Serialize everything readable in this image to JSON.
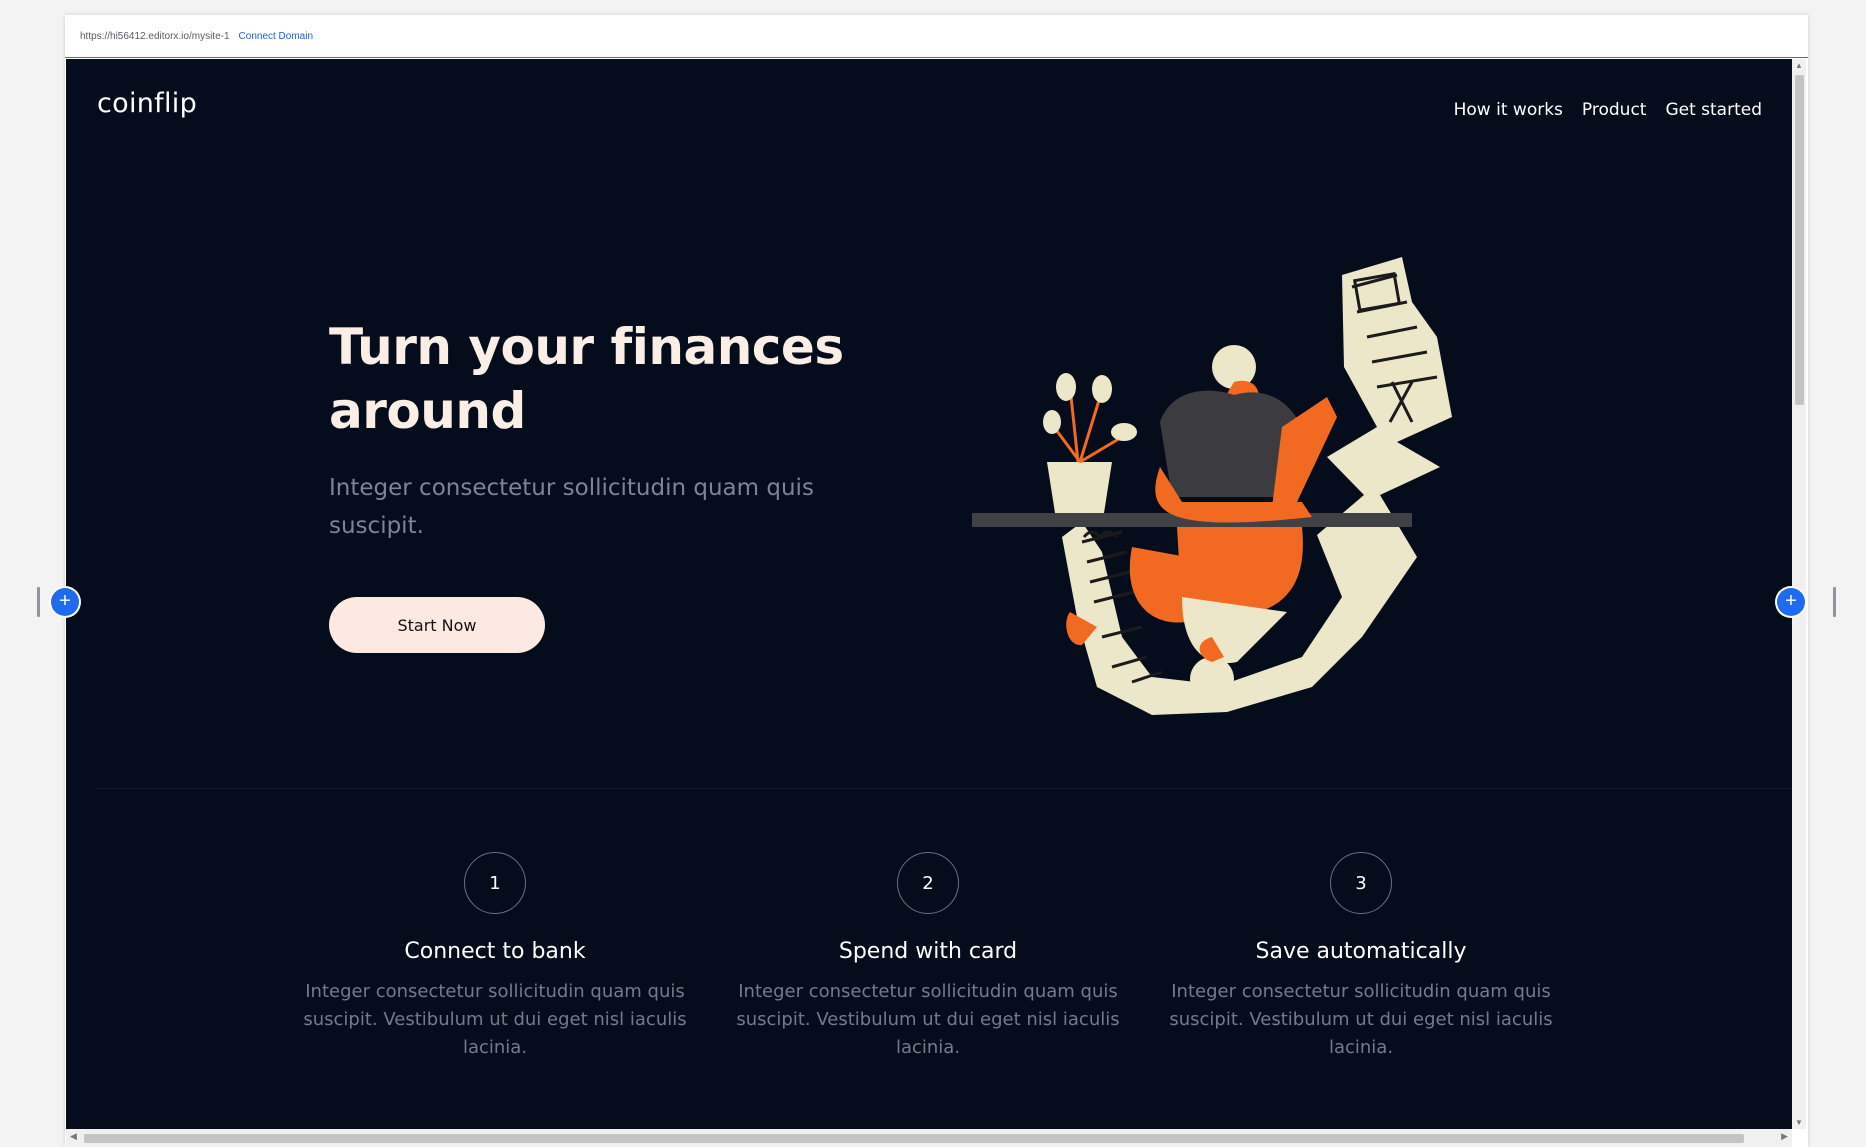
{
  "editor": {
    "url": "https://hi56412.editorx.io/mysite-1",
    "connect_domain": "Connect Domain"
  },
  "site": {
    "logo": "coinflip",
    "nav": [
      "How it works",
      "Product",
      "Get started"
    ],
    "hero": {
      "title": "Turn your finances around",
      "subtitle": "Integer consectetur sollicitudin quam quis suscipit.",
      "cta": "Start Now"
    },
    "steps": [
      {
        "number": "1",
        "title": "Connect to bank",
        "description": "Integer consectetur sollicitudin quam quis suscipit. Vestibulum ut dui eget nisl iaculis lacinia."
      },
      {
        "number": "2",
        "title": "Spend with card",
        "description": "Integer consectetur sollicitudin quam quis suscipit. Vestibulum ut dui eget nisl iaculis lacinia."
      },
      {
        "number": "3",
        "title": "Save automatically",
        "description": "Integer consectetur sollicitudin quam quis suscipit. Vestibulum ut dui eget nisl iaculis lacinia."
      }
    ]
  },
  "colors": {
    "site_background": "#050d1c",
    "accent_orange": "#f26a21",
    "cream": "#ece7c8",
    "cta_background": "#fde9e1",
    "editor_blue": "#1e6bf0"
  },
  "icons": {
    "add_section_left": "plus-icon",
    "add_section_right": "plus-icon",
    "scroll_up": "triangle-up",
    "scroll_down": "triangle-down",
    "scroll_left": "triangle-left",
    "scroll_right": "triangle-right"
  }
}
